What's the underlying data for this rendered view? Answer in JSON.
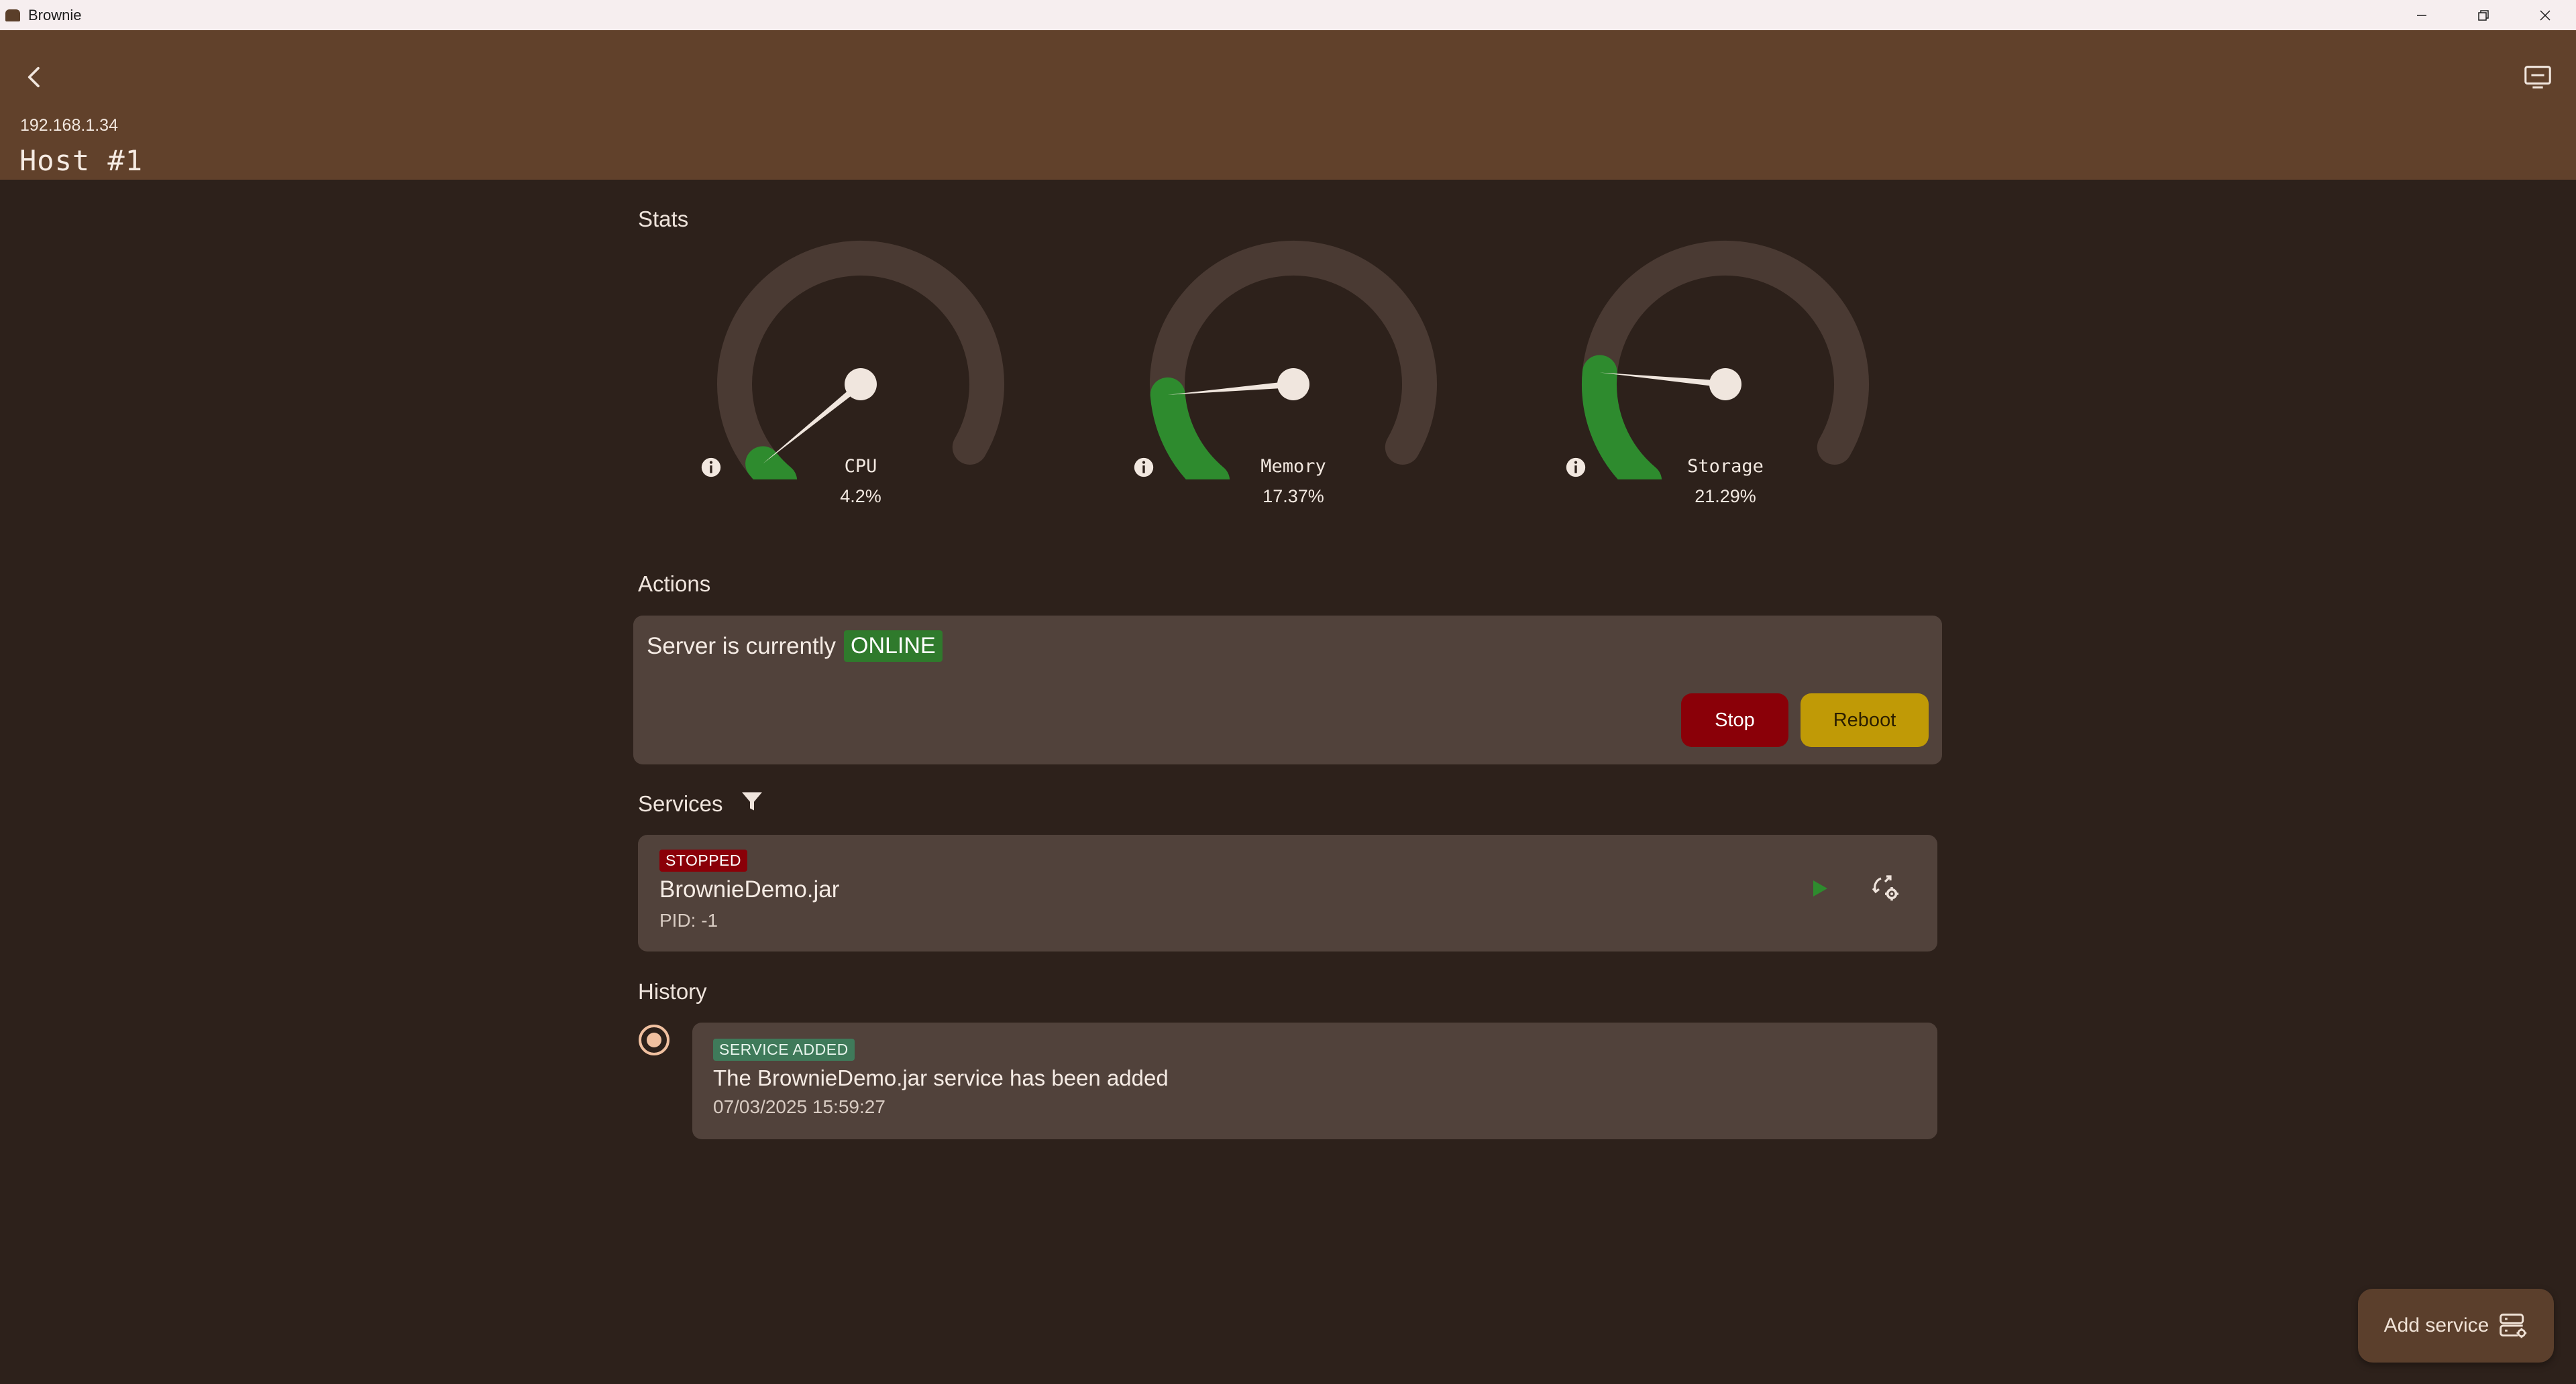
{
  "window": {
    "title": "Brownie"
  },
  "header": {
    "ip": "192.168.1.34",
    "host_name": "Host #1"
  },
  "stats": {
    "title": "Stats",
    "gauges": [
      {
        "label": "CPU",
        "value_text": "4.2%",
        "value": 4.2
      },
      {
        "label": "Memory",
        "value_text": "17.37%",
        "value": 17.37
      },
      {
        "label": "Storage",
        "value_text": "21.29%",
        "value": 21.29
      }
    ],
    "colors": {
      "track": "#4a3a33",
      "fill": "#2e8b2e",
      "needle": "#f0e6de"
    }
  },
  "actions": {
    "title": "Actions",
    "status_text": "Server is currently",
    "status_badge": "ONLINE",
    "stop_label": "Stop",
    "reboot_label": "Reboot"
  },
  "services": {
    "title": "Services",
    "filter_icon": "filter-icon",
    "items": [
      {
        "status": "STOPPED",
        "name": "BrownieDemo.jar",
        "pid": "PID: -1"
      }
    ]
  },
  "history": {
    "title": "History",
    "items": [
      {
        "badge": "SERVICE ADDED",
        "message": "The BrownieDemo.jar service has been added",
        "time": "07/03/2025 15:59:27"
      }
    ]
  },
  "fab": {
    "label": "Add service"
  },
  "colors": {
    "background": "#2d211b",
    "appbar": "#61412b",
    "card": "#51423b",
    "stop": "#8a0008",
    "reboot": "#c09a06",
    "online": "#2f7a2c"
  }
}
